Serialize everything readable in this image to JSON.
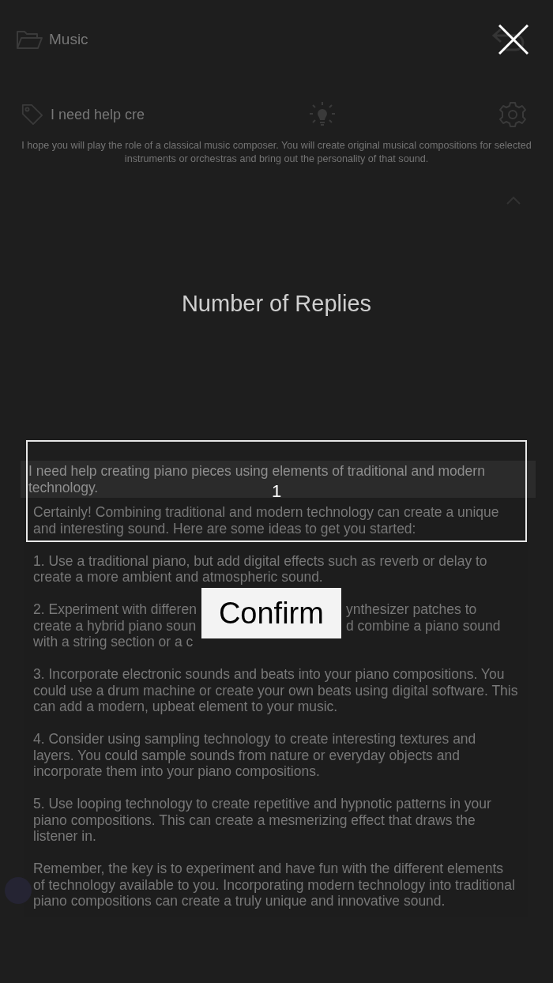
{
  "app": {
    "folder": "Music",
    "prompt_tag": "I need help cre",
    "prompt_description": "I hope you will play the role of a classical music composer. You will create original musical compositions for selected instruments or orchestras and bring out the personality of that sound.",
    "user_message": "I need help creating piano pieces using elements of traditional and modern technology.",
    "reply_paragraphs": [
      {
        "kind": "text",
        "text": "Certainly! Combining traditional and modern technology can create a unique and interesting sound. Here are some ideas to get you started:"
      },
      {
        "kind": "text",
        "text": "1. Use a traditional piano, but add digital effects such as reverb or delay to create a more ambient and atmospheric sound."
      },
      {
        "kind": "split",
        "lines": [
          {
            "left": "2. Experiment with differen",
            "right": "ynthesizer patches to"
          },
          {
            "left": "create a hybrid piano soun",
            "right": "d combine a piano sound"
          },
          {
            "left": "with a string section or a c"
          }
        ]
      },
      {
        "kind": "text",
        "text": "3. Incorporate electronic sounds and beats into your piano compositions. You could use a drum machine or create your own beats using digital software. This can add a modern, upbeat element to your music."
      },
      {
        "kind": "text",
        "text": "4. Consider using sampling technology to create interesting textures and layers. You could sample sounds from nature or everyday objects and incorporate them into your piano compositions."
      },
      {
        "kind": "text",
        "text": "5. Use looping technology to create repetitive and hypnotic patterns in your piano compositions. This can create a mesmerizing effect that draws the listener in."
      },
      {
        "kind": "text",
        "text": "Remember, the key is to experiment and have fun with the different elements of technology available to you. Incorporating modern technology into traditional piano compositions can create a truly unique and innovative sound."
      }
    ]
  },
  "dialog": {
    "title": "Number of Replies",
    "value": "1",
    "confirm": "Confirm"
  }
}
